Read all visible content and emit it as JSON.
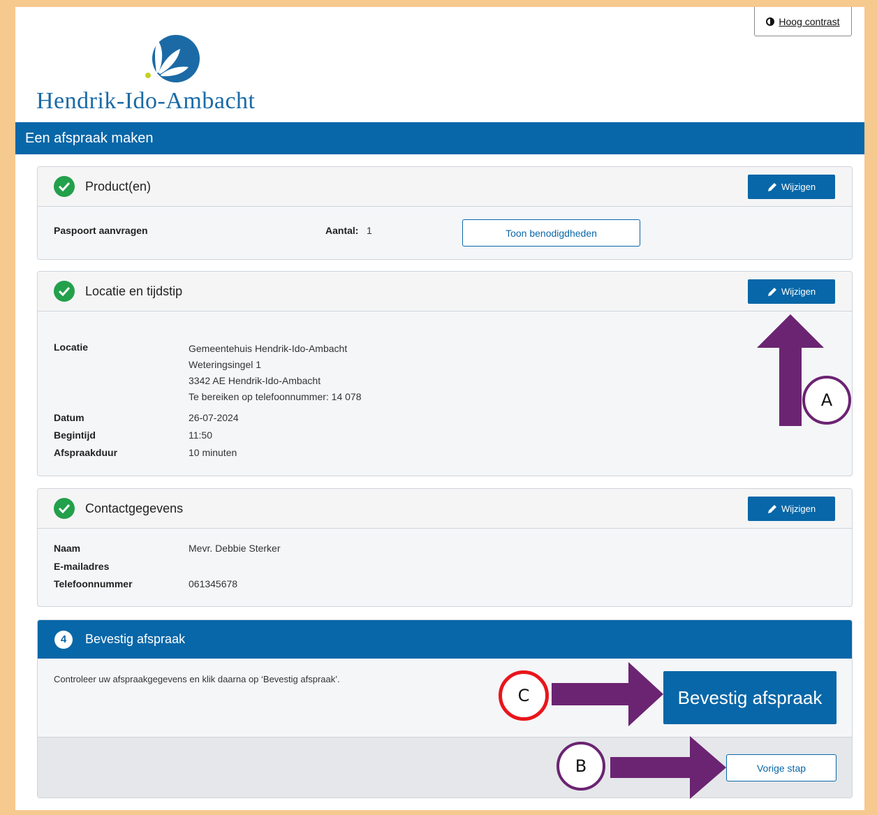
{
  "contrast": {
    "label": "Hoog contrast"
  },
  "logo": {
    "name": "Hendrik-Ido-Ambacht"
  },
  "header": {
    "title": "Een afspraak maken"
  },
  "sections": {
    "products": {
      "title": "Product(en)",
      "edit_label": "Wijzigen",
      "product_name": "Paspoort aanvragen",
      "amount_label": "Aantal:",
      "amount_value": "1",
      "requirements_button": "Toon benodigdheden"
    },
    "location": {
      "title": "Locatie en tijdstip",
      "edit_label": "Wijzigen",
      "location_label": "Locatie",
      "location_lines": [
        "Gemeentehuis Hendrik-Ido-Ambacht",
        "Weteringsingel 1",
        "3342 AE Hendrik-Ido-Ambacht",
        "Te bereiken op telefoonnummer: 14 078"
      ],
      "date_label": "Datum",
      "date_value": "26-07-2024",
      "start_label": "Begintijd",
      "start_value": "11:50",
      "duration_label": "Afspraakduur",
      "duration_value": "10 minuten"
    },
    "contact": {
      "title": "Contactgegevens",
      "edit_label": "Wijzigen",
      "name_label": "Naam",
      "name_value": "Mevr. Debbie Sterker",
      "email_label": "E-mailadres",
      "phone_label": "Telefoonnummer",
      "phone_value": "061345678"
    },
    "confirm": {
      "step": "4",
      "title": "Bevestig afspraak",
      "instruction": "Controleer uw afspraakgegevens en klik daarna op ‘Bevestig afspraak’.",
      "confirm_button": "Bevestig afspraak",
      "previous_button": "Vorige stap"
    }
  },
  "annotations": {
    "a": "A",
    "b": "B",
    "c": "C"
  },
  "colors": {
    "primary": "#0867a8",
    "success": "#23a04b",
    "annotation_arrow": "#6b2472",
    "annotation_c_border": "#e8161b",
    "frame": "#f6c98f"
  }
}
